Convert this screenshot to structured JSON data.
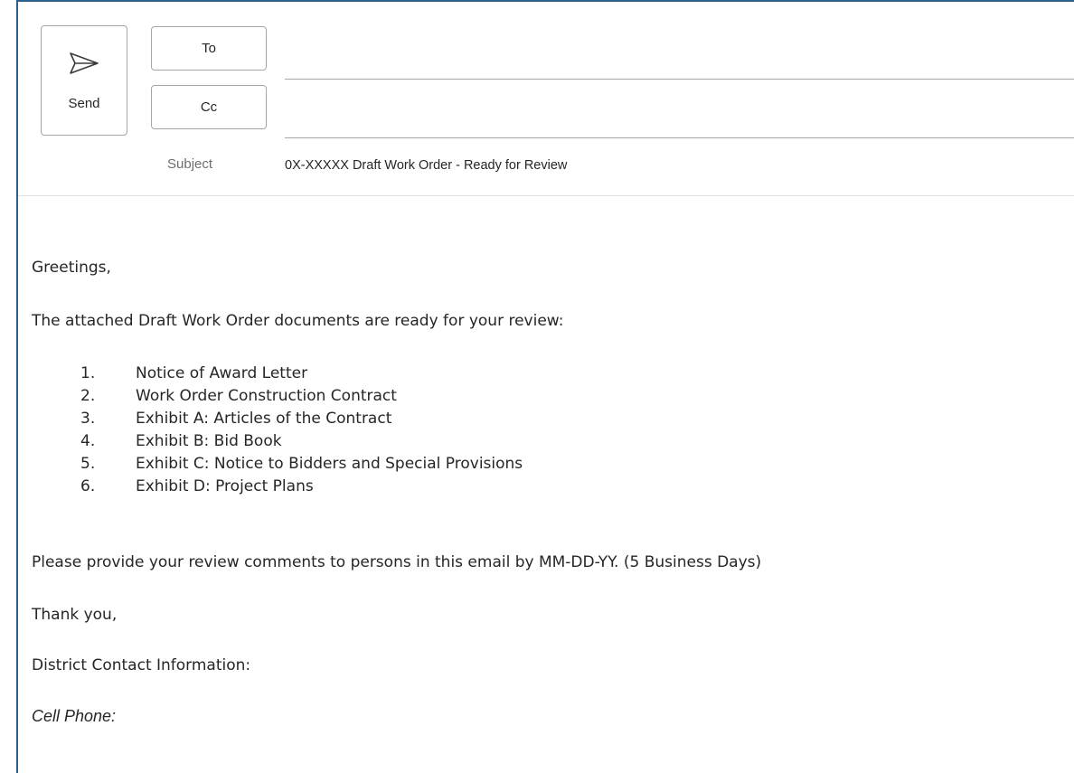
{
  "compose": {
    "send_label": "Send",
    "to_label": "To",
    "cc_label": "Cc",
    "to_value": "",
    "cc_value": "",
    "subject_label": "Subject",
    "subject_value": "0X-XXXXX Draft Work Order - Ready for Review"
  },
  "message": {
    "greeting": "Greetings,",
    "intro": "The attached Draft Work Order documents are ready for your review:",
    "documents": [
      {
        "num": "1.",
        "text": "Notice of Award Letter"
      },
      {
        "num": "2.",
        "text": "Work Order Construction Contract"
      },
      {
        "num": "3.",
        "text": "Exhibit A: Articles of the Contract"
      },
      {
        "num": "4.",
        "text": "Exhibit B: Bid Book"
      },
      {
        "num": "5.",
        "text": "Exhibit C: Notice to Bidders and Special Provisions"
      },
      {
        "num": "6.",
        "text": "Exhibit D: Project Plans"
      }
    ],
    "request": "Please provide your review comments to persons in this email by MM-DD-YY. (5 Business Days)",
    "thanks": "Thank you,",
    "contact": "District Contact Information:",
    "cell_phone": "Cell Phone:"
  },
  "icons": {
    "send": "send-icon"
  },
  "colors": {
    "frame_border": "#2c5f8a",
    "button_border": "#a6a6a6",
    "text": "#262626",
    "label_muted": "#6e6e6e"
  }
}
